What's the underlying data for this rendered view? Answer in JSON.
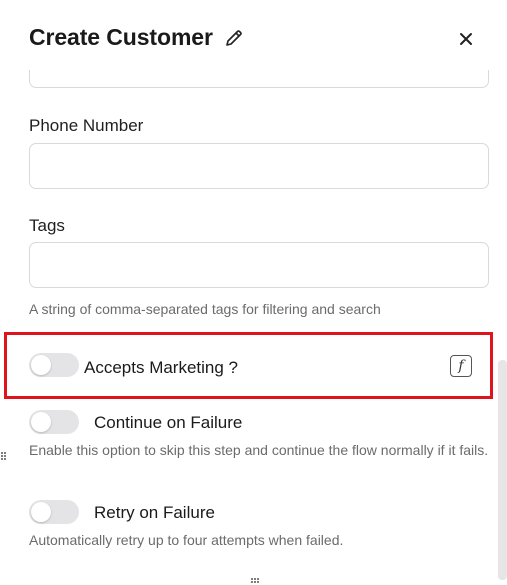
{
  "header": {
    "title": "Create Customer"
  },
  "fields": {
    "phone": {
      "label": "Phone Number",
      "value": "",
      "placeholder": ""
    },
    "tags": {
      "label": "Tags",
      "value": "",
      "placeholder": "",
      "hint": "A string of comma-separated tags for filtering and search"
    }
  },
  "toggles": {
    "accepts_marketing": {
      "label": "Accepts Marketing ?",
      "on": false
    },
    "continue_on_failure": {
      "label": "Continue on Failure",
      "on": false,
      "hint": "Enable this option to skip this step and continue the flow normally if it fails."
    },
    "retry_on_failure": {
      "label": "Retry on Failure",
      "on": false,
      "hint": "Automatically retry up to four attempts when failed."
    }
  },
  "formula_icon": "f",
  "colors": {
    "highlight": "#e0141c",
    "toggle_off": "#e4e4e6"
  }
}
